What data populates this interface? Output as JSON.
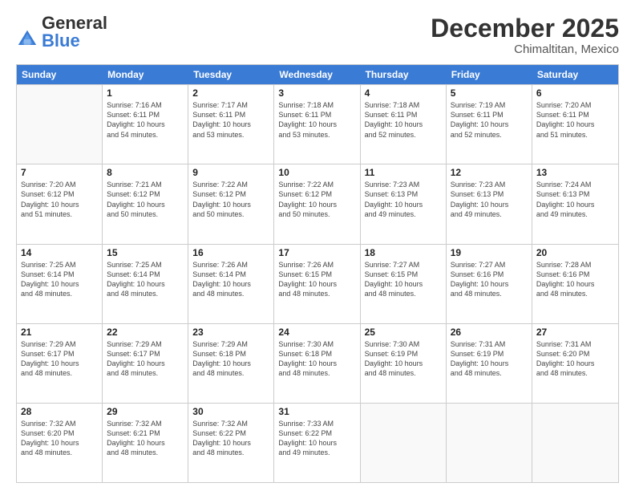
{
  "logo": {
    "general": "General",
    "blue": "Blue"
  },
  "header": {
    "title": "December 2025",
    "subtitle": "Chimaltitan, Mexico"
  },
  "calendar": {
    "days": [
      "Sunday",
      "Monday",
      "Tuesday",
      "Wednesday",
      "Thursday",
      "Friday",
      "Saturday"
    ],
    "rows": [
      [
        {
          "num": "",
          "info": ""
        },
        {
          "num": "1",
          "info": "Sunrise: 7:16 AM\nSunset: 6:11 PM\nDaylight: 10 hours\nand 54 minutes."
        },
        {
          "num": "2",
          "info": "Sunrise: 7:17 AM\nSunset: 6:11 PM\nDaylight: 10 hours\nand 53 minutes."
        },
        {
          "num": "3",
          "info": "Sunrise: 7:18 AM\nSunset: 6:11 PM\nDaylight: 10 hours\nand 53 minutes."
        },
        {
          "num": "4",
          "info": "Sunrise: 7:18 AM\nSunset: 6:11 PM\nDaylight: 10 hours\nand 52 minutes."
        },
        {
          "num": "5",
          "info": "Sunrise: 7:19 AM\nSunset: 6:11 PM\nDaylight: 10 hours\nand 52 minutes."
        },
        {
          "num": "6",
          "info": "Sunrise: 7:20 AM\nSunset: 6:11 PM\nDaylight: 10 hours\nand 51 minutes."
        }
      ],
      [
        {
          "num": "7",
          "info": "Sunrise: 7:20 AM\nSunset: 6:12 PM\nDaylight: 10 hours\nand 51 minutes."
        },
        {
          "num": "8",
          "info": "Sunrise: 7:21 AM\nSunset: 6:12 PM\nDaylight: 10 hours\nand 50 minutes."
        },
        {
          "num": "9",
          "info": "Sunrise: 7:22 AM\nSunset: 6:12 PM\nDaylight: 10 hours\nand 50 minutes."
        },
        {
          "num": "10",
          "info": "Sunrise: 7:22 AM\nSunset: 6:12 PM\nDaylight: 10 hours\nand 50 minutes."
        },
        {
          "num": "11",
          "info": "Sunrise: 7:23 AM\nSunset: 6:13 PM\nDaylight: 10 hours\nand 49 minutes."
        },
        {
          "num": "12",
          "info": "Sunrise: 7:23 AM\nSunset: 6:13 PM\nDaylight: 10 hours\nand 49 minutes."
        },
        {
          "num": "13",
          "info": "Sunrise: 7:24 AM\nSunset: 6:13 PM\nDaylight: 10 hours\nand 49 minutes."
        }
      ],
      [
        {
          "num": "14",
          "info": "Sunrise: 7:25 AM\nSunset: 6:14 PM\nDaylight: 10 hours\nand 48 minutes."
        },
        {
          "num": "15",
          "info": "Sunrise: 7:25 AM\nSunset: 6:14 PM\nDaylight: 10 hours\nand 48 minutes."
        },
        {
          "num": "16",
          "info": "Sunrise: 7:26 AM\nSunset: 6:14 PM\nDaylight: 10 hours\nand 48 minutes."
        },
        {
          "num": "17",
          "info": "Sunrise: 7:26 AM\nSunset: 6:15 PM\nDaylight: 10 hours\nand 48 minutes."
        },
        {
          "num": "18",
          "info": "Sunrise: 7:27 AM\nSunset: 6:15 PM\nDaylight: 10 hours\nand 48 minutes."
        },
        {
          "num": "19",
          "info": "Sunrise: 7:27 AM\nSunset: 6:16 PM\nDaylight: 10 hours\nand 48 minutes."
        },
        {
          "num": "20",
          "info": "Sunrise: 7:28 AM\nSunset: 6:16 PM\nDaylight: 10 hours\nand 48 minutes."
        }
      ],
      [
        {
          "num": "21",
          "info": "Sunrise: 7:29 AM\nSunset: 6:17 PM\nDaylight: 10 hours\nand 48 minutes."
        },
        {
          "num": "22",
          "info": "Sunrise: 7:29 AM\nSunset: 6:17 PM\nDaylight: 10 hours\nand 48 minutes."
        },
        {
          "num": "23",
          "info": "Sunrise: 7:29 AM\nSunset: 6:18 PM\nDaylight: 10 hours\nand 48 minutes."
        },
        {
          "num": "24",
          "info": "Sunrise: 7:30 AM\nSunset: 6:18 PM\nDaylight: 10 hours\nand 48 minutes."
        },
        {
          "num": "25",
          "info": "Sunrise: 7:30 AM\nSunset: 6:19 PM\nDaylight: 10 hours\nand 48 minutes."
        },
        {
          "num": "26",
          "info": "Sunrise: 7:31 AM\nSunset: 6:19 PM\nDaylight: 10 hours\nand 48 minutes."
        },
        {
          "num": "27",
          "info": "Sunrise: 7:31 AM\nSunset: 6:20 PM\nDaylight: 10 hours\nand 48 minutes."
        }
      ],
      [
        {
          "num": "28",
          "info": "Sunrise: 7:32 AM\nSunset: 6:20 PM\nDaylight: 10 hours\nand 48 minutes."
        },
        {
          "num": "29",
          "info": "Sunrise: 7:32 AM\nSunset: 6:21 PM\nDaylight: 10 hours\nand 48 minutes."
        },
        {
          "num": "30",
          "info": "Sunrise: 7:32 AM\nSunset: 6:22 PM\nDaylight: 10 hours\nand 48 minutes."
        },
        {
          "num": "31",
          "info": "Sunrise: 7:33 AM\nSunset: 6:22 PM\nDaylight: 10 hours\nand 49 minutes."
        },
        {
          "num": "",
          "info": ""
        },
        {
          "num": "",
          "info": ""
        },
        {
          "num": "",
          "info": ""
        }
      ]
    ]
  }
}
